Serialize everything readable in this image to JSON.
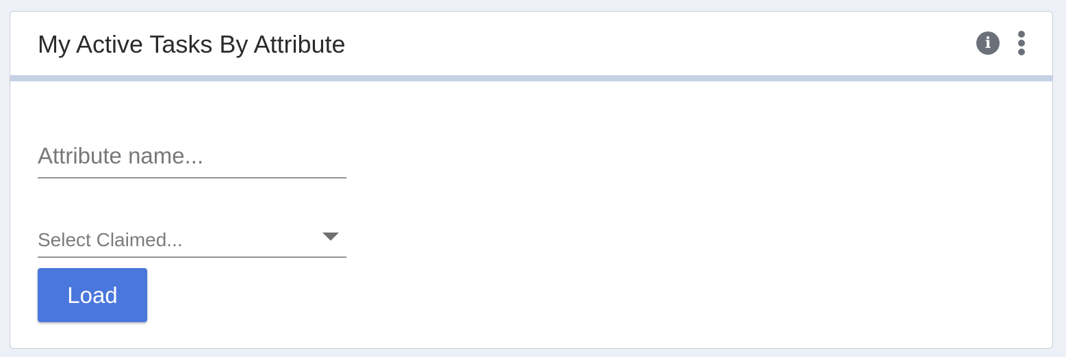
{
  "widget": {
    "title": "My Active Tasks By Attribute",
    "info_icon": "info-icon",
    "info_glyph": "i",
    "menu_icon": "more-vertical-icon"
  },
  "form": {
    "attribute_input": {
      "value": "",
      "placeholder": "Attribute name..."
    },
    "claimed_select": {
      "selected_label": "Select Claimed...",
      "icon": "caret-down-icon"
    },
    "load_button": {
      "label": "Load"
    }
  },
  "colors": {
    "accent": "#4a77dc",
    "header_rule": "#c5d1e5",
    "icon": "#6b7079"
  }
}
